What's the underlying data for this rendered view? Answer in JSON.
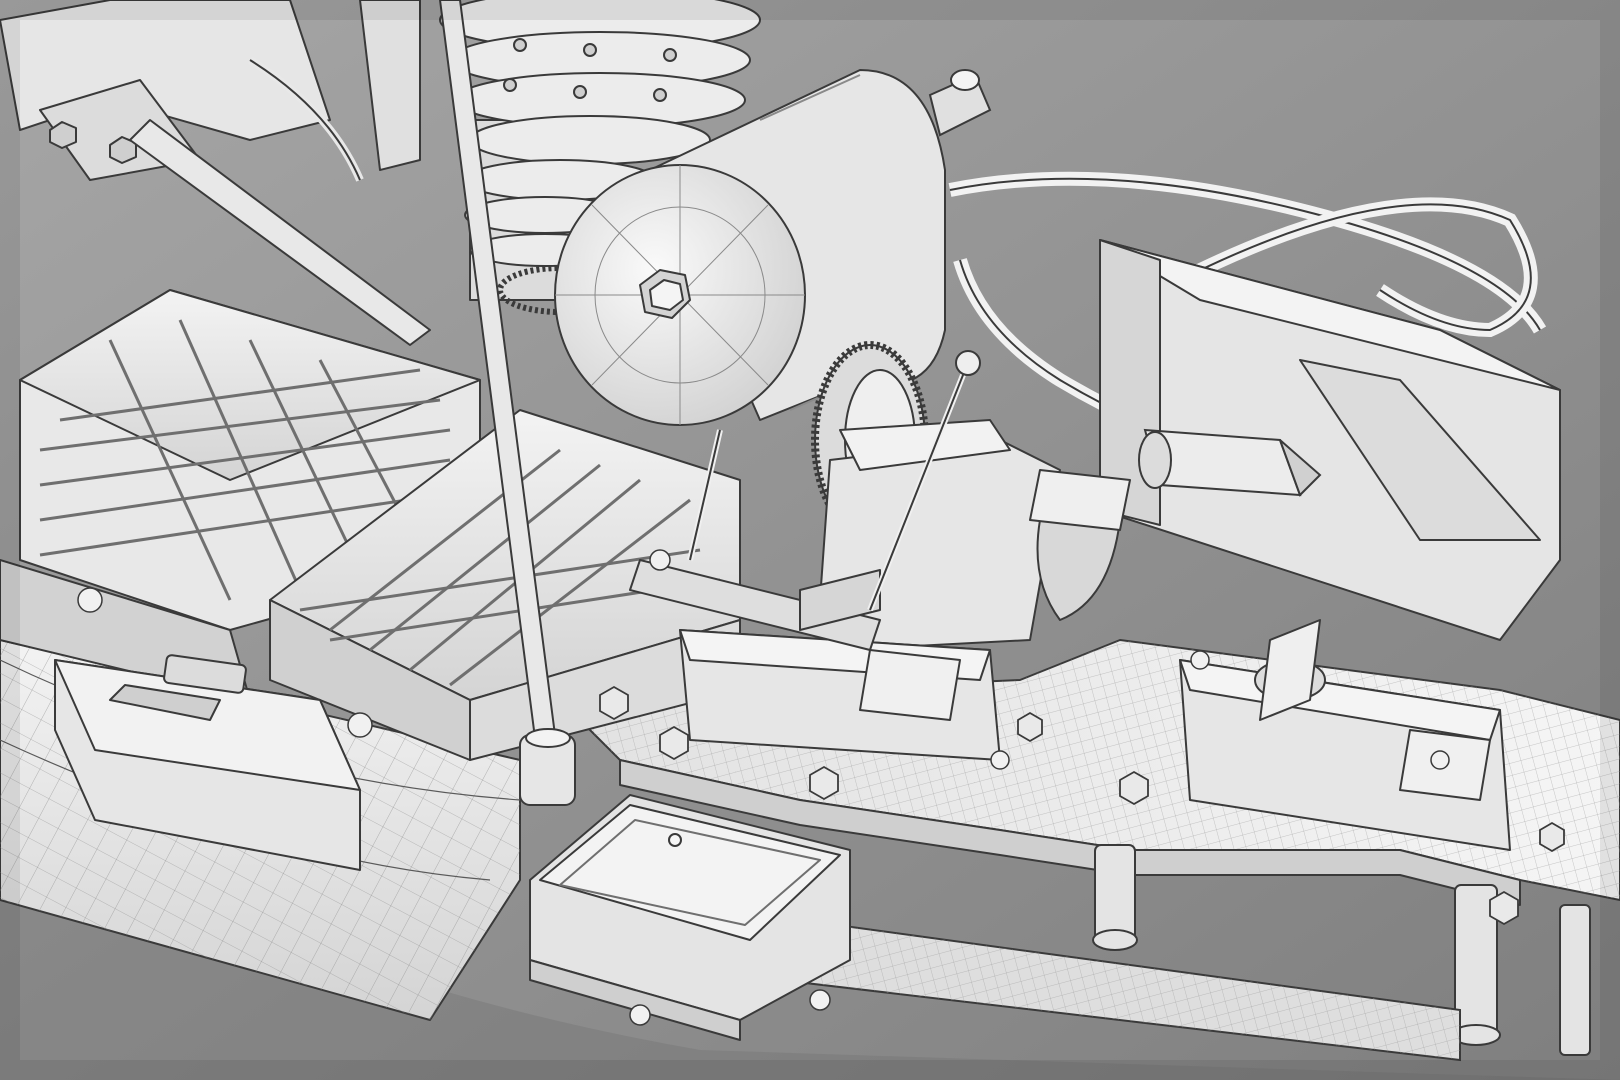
{
  "image": {
    "subject": "rc-buggy-chassis-wireframe-render",
    "colors": {
      "background_light": "#a9a9a9",
      "background_dark": "#7a7a7a",
      "model_fill": "#e9e9e9",
      "model_shadow": "#cfcfcf",
      "wire": "#6f6f6f",
      "edge": "#3a3a3a"
    }
  }
}
